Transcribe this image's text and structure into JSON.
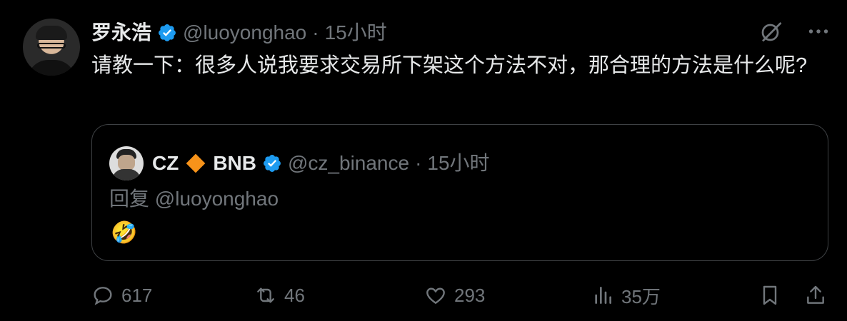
{
  "tweet": {
    "author_name": "罗永浩",
    "handle": "@luoyonghao",
    "separator": "·",
    "time": "15小时",
    "text": "请教一下：很多人说我要求交易所下架这个方法不对，那合理的方法是什么呢?"
  },
  "quote": {
    "author_name": "CZ",
    "author_suffix": "BNB",
    "handle": "@cz_binance",
    "separator": "·",
    "time": "15小时",
    "reply_prefix": "回复",
    "reply_to": "@luoyonghao",
    "emoji": "🤣"
  },
  "actions": {
    "replies": "617",
    "retweets": "46",
    "likes": "293",
    "views": "35万"
  },
  "icons": {
    "verified": "verified-badge-icon",
    "grok": "grok-icon",
    "more": "more-icon",
    "diamond": "orange-diamond-icon",
    "reply": "reply-icon",
    "retweet": "retweet-icon",
    "like": "heart-icon",
    "views": "views-chart-icon",
    "bookmark": "bookmark-icon",
    "share": "share-icon"
  },
  "colors": {
    "background": "#000000",
    "text": "#e7e9ea",
    "secondary": "#71767b",
    "verified": "#1d9bf0",
    "diamond": "#f7931a",
    "border": "#3e4144"
  }
}
